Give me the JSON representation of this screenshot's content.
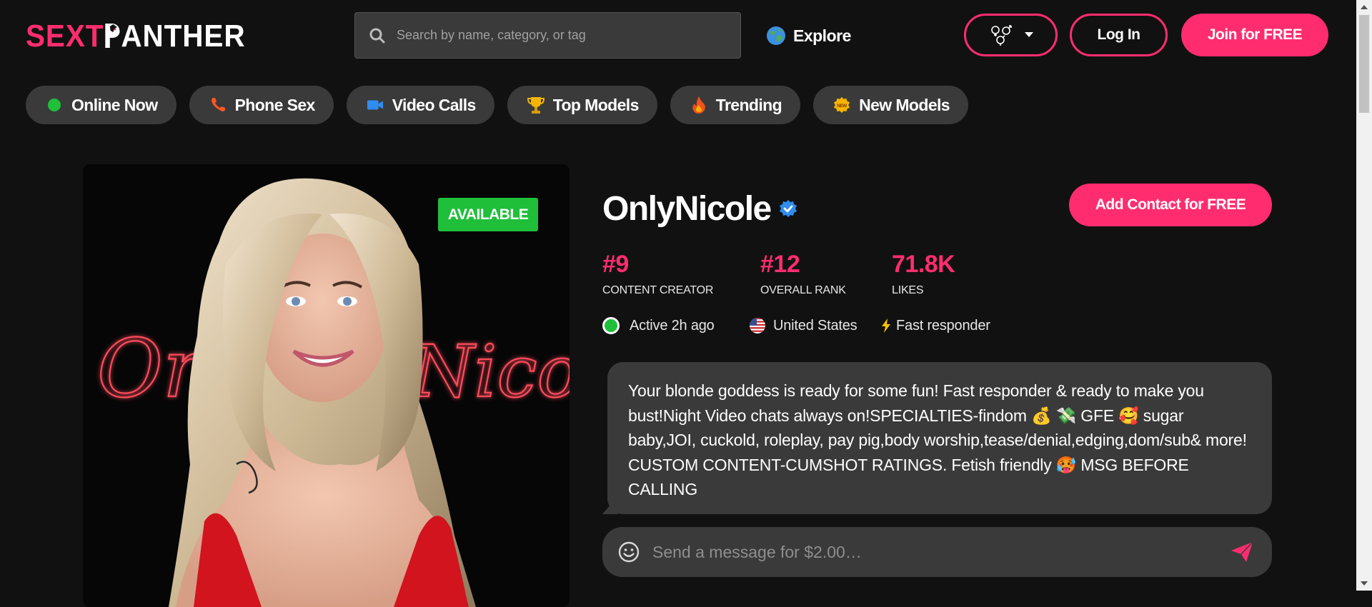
{
  "brand": {
    "part1": "SEXT",
    "part2": "ANTHER",
    "accent": "#ff2d6f"
  },
  "header": {
    "search_placeholder": "Search by name, category, or tag",
    "explore_label": "Explore",
    "login_label": "Log In",
    "join_label": "Join for FREE"
  },
  "categories": [
    {
      "label": "Online Now",
      "icon": "green-dot-icon"
    },
    {
      "label": "Phone Sex",
      "icon": "phone-icon"
    },
    {
      "label": "Video Calls",
      "icon": "video-camera-icon"
    },
    {
      "label": "Top Models",
      "icon": "trophy-icon"
    },
    {
      "label": "Trending",
      "icon": "fire-icon"
    },
    {
      "label": "New Models",
      "icon": "new-badge-icon"
    }
  ],
  "profile": {
    "availability": "AVAILABLE",
    "photo_neon_text": [
      "Only",
      "Nicole"
    ],
    "name": "OnlyNicole",
    "add_contact_label": "Add Contact for FREE",
    "stats": [
      {
        "value": "#9",
        "label": "CONTENT CREATOR"
      },
      {
        "value": "#12",
        "label": "OVERALL RANK"
      },
      {
        "value": "71.8K",
        "label": "LIKES"
      }
    ],
    "status": "Active 2h ago",
    "country": "United States",
    "responder": "Fast responder",
    "bio": "Your blonde goddess is ready for some fun! Fast responder & ready to make you bust!Night Video chats always on!SPECIALTIES-findom 💰 💸 GFE 🥰 sugar baby,JOI, cuckold, roleplay, pay pig,body worship,tease/denial,edging,dom/sub& more! CUSTOM CONTENT-CUMSHOT RATINGS. Fetish friendly 🥵 MSG BEFORE CALLING",
    "message_placeholder": "Send a message for $2.00…"
  }
}
